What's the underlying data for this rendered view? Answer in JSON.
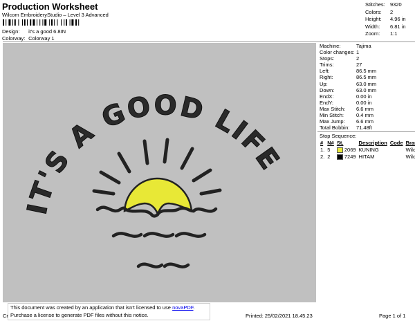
{
  "header": {
    "title": "Production Worksheet",
    "subtitle": "Wilcom EmbroideryStudio – Level 3 Advanced"
  },
  "meta": {
    "design_label": "Design:",
    "design_value": "it's a good 6.8IN",
    "colorway_label": "Colorway:",
    "colorway_value": "Colorway 1"
  },
  "summary": [
    {
      "k": "Stitches:",
      "v": "9320"
    },
    {
      "k": "Colors:",
      "v": "2"
    },
    {
      "k": "Height:",
      "v": "4.96 in"
    },
    {
      "k": "Width:",
      "v": "6.81 in"
    },
    {
      "k": "Zoom:",
      "v": "1:1"
    }
  ],
  "design": {
    "text": "IT'S A GOOD LIFE",
    "sun_color": "#e8e836",
    "stroke_color": "#222222",
    "background": "#c0c0c0"
  },
  "machine_info": [
    {
      "k": "Machine:",
      "v": "Tajima"
    },
    {
      "k": "Color changes:",
      "v": "1"
    },
    {
      "k": "Stops:",
      "v": "2"
    },
    {
      "k": "Trims:",
      "v": "27"
    },
    {
      "k": "Left:",
      "v": "86.5 mm"
    },
    {
      "k": "Right:",
      "v": "86.5 mm"
    },
    {
      "k": "Up:",
      "v": "63.0 mm"
    },
    {
      "k": "Down:",
      "v": "63.0 mm"
    },
    {
      "k": "EndX:",
      "v": "0.00 in"
    },
    {
      "k": "EndY:",
      "v": "0.00 in"
    },
    {
      "k": "Max Stitch:",
      "v": "6.6 mm"
    },
    {
      "k": "Min Stitch:",
      "v": "0.4 mm"
    },
    {
      "k": "Max Jump:",
      "v": "6.6 mm"
    },
    {
      "k": "Total Bobbin:",
      "v": "71.48ft"
    }
  ],
  "stop_sequence": {
    "title": "Stop Sequence:",
    "headers": [
      "#",
      "N#",
      "St.",
      "Description",
      "Code",
      "Brand"
    ],
    "rows": [
      {
        "num": "1.",
        "n": "5",
        "color": "#e8e836",
        "st": "2069",
        "desc": "KUNING",
        "code": "",
        "brand": "Wilcom"
      },
      {
        "num": "2.",
        "n": "2",
        "color": "#000000",
        "st": "7249",
        "desc": "HITAM",
        "code": "",
        "brand": "Wilcom"
      }
    ]
  },
  "notice": {
    "line1_prefix": "This document was created by an application that isn't licensed to use ",
    "link": "novaPDF",
    "line1_suffix": ".",
    "line2": "Purchase a license to generate PDF files without this notice."
  },
  "footer": {
    "left": "Cr",
    "printed": "Printed: 25/02/2021 18.45.23",
    "page": "Page 1 of 1"
  }
}
